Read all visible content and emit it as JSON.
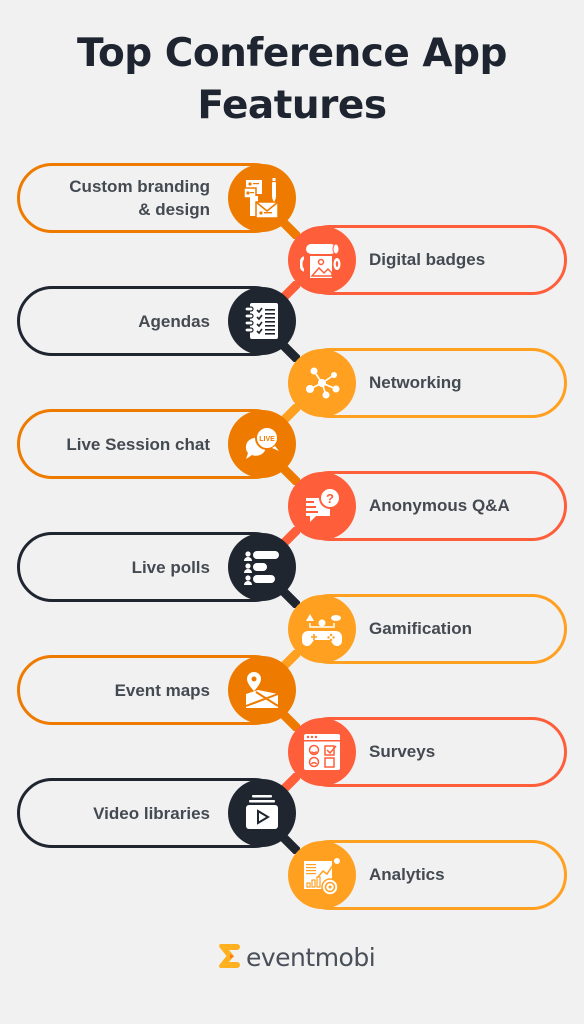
{
  "title": {
    "line1": "Top Conference App",
    "line2": "Features"
  },
  "colors": {
    "dark_orange": "#ee7b00",
    "coral": "#ff5e3a",
    "navy": "#1f2630",
    "amber": "#ffa020",
    "background": "#f1f1f1",
    "text": "#444a52"
  },
  "features": [
    {
      "label": "Custom branding\n& design",
      "line1": "Custom branding",
      "line2": "& design",
      "side": "left",
      "color": "#ee7b00",
      "icon": "branding-stationery-icon"
    },
    {
      "label": "Digital badges",
      "side": "right",
      "color": "#ff5e3a",
      "icon": "badge-print-icon"
    },
    {
      "label": "Agendas",
      "side": "left",
      "color": "#1f2630",
      "icon": "agenda-notebook-icon"
    },
    {
      "label": "Networking",
      "side": "right",
      "color": "#ffa020",
      "icon": "network-nodes-icon"
    },
    {
      "label": "Live Session chat",
      "side": "left",
      "color": "#ee7b00",
      "icon": "live-chat-icon"
    },
    {
      "label": "Anonymous Q&A",
      "side": "right",
      "color": "#ff5e3a",
      "icon": "question-chat-icon"
    },
    {
      "label": "Live polls",
      "side": "left",
      "color": "#1f2630",
      "icon": "poll-bars-icon"
    },
    {
      "label": "Gamification",
      "side": "right",
      "color": "#ffa020",
      "icon": "gamepad-icon"
    },
    {
      "label": "Event maps",
      "side": "left",
      "color": "#ee7b00",
      "icon": "map-pin-icon"
    },
    {
      "label": "Surveys",
      "side": "right",
      "color": "#ff5e3a",
      "icon": "survey-form-icon"
    },
    {
      "label": "Video libraries",
      "side": "left",
      "color": "#1f2630",
      "icon": "video-library-icon"
    },
    {
      "label": "Analytics",
      "side": "right",
      "color": "#ffa020",
      "icon": "analytics-chart-icon"
    }
  ],
  "logo": {
    "text": "eventmobi",
    "mark_color": "#ffb020"
  }
}
